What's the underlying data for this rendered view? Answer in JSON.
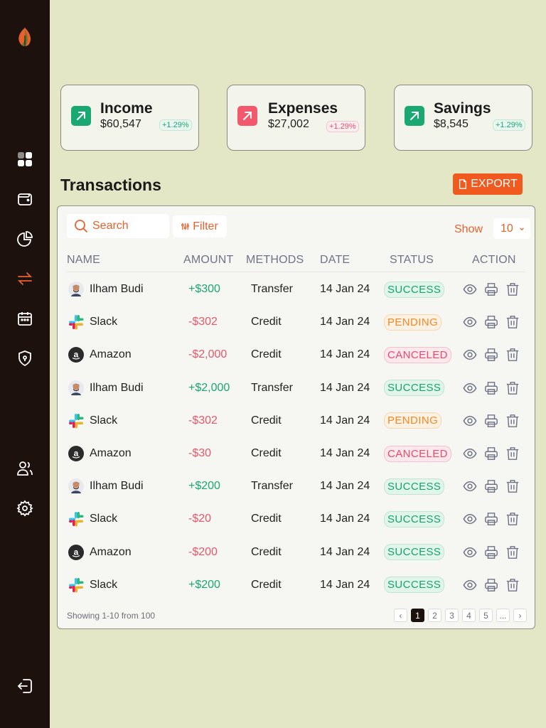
{
  "colors": {
    "sidebar": "#1d110d",
    "accent": "#f05a1f",
    "background": "#e4e7c6",
    "success": "#14a370",
    "pending": "#f08a2c",
    "canceled": "#e84a6a"
  },
  "sidebar": {
    "logo": "leaf-logo",
    "items": [
      {
        "name": "dashboard",
        "icon": "grid-icon"
      },
      {
        "name": "wallet",
        "icon": "wallet-icon"
      },
      {
        "name": "analytics",
        "icon": "pie-chart-icon"
      },
      {
        "name": "transactions",
        "icon": "transfer-icon",
        "active": true
      },
      {
        "name": "calendar",
        "icon": "calendar-icon"
      },
      {
        "name": "security",
        "icon": "shield-icon"
      },
      {
        "name": "users",
        "icon": "users-icon"
      },
      {
        "name": "settings",
        "icon": "gear-icon"
      },
      {
        "name": "logout",
        "icon": "logout-icon"
      }
    ]
  },
  "cards": [
    {
      "title": "Income",
      "value": "$60,547",
      "delta": "+1.29%",
      "color": "#1aa872"
    },
    {
      "title": "Expenses",
      "value": "$27,002",
      "delta": "+1.29%",
      "color": "#f2596c"
    },
    {
      "title": "Savings",
      "value": "$8,545",
      "delta": "+1.29%",
      "color": "#1aa872"
    }
  ],
  "transactions": {
    "title": "Transactions",
    "export_label": "EXPORT",
    "search_placeholder": "Search",
    "filter_label": "Filter",
    "show_label": "Show",
    "show_value": "10",
    "columns": [
      "NAME",
      "AMOUNT",
      "METHODS",
      "DATE",
      "STATUS",
      "ACTION"
    ],
    "rows": [
      {
        "name": "Ilham Budi",
        "avatar": "person-avatar",
        "amount": "+$300",
        "method": "Transfer",
        "date": "14 Jan 24",
        "status": "SUCCESS"
      },
      {
        "name": "Slack",
        "avatar": "slack-logo",
        "amount": "-$302",
        "method": "Credit",
        "date": "14 Jan 24",
        "status": "PENDING"
      },
      {
        "name": "Amazon",
        "avatar": "amazon-logo",
        "amount": "-$2,000",
        "method": "Credit",
        "date": "14 Jan 24",
        "status": "CANCELED"
      },
      {
        "name": "Ilham Budi",
        "avatar": "person-avatar",
        "amount": "+$2,000",
        "method": "Transfer",
        "date": "14 Jan 24",
        "status": "SUCCESS"
      },
      {
        "name": "Slack",
        "avatar": "slack-logo",
        "amount": "-$302",
        "method": "Credit",
        "date": "14 Jan 24",
        "status": "PENDING"
      },
      {
        "name": "Amazon",
        "avatar": "amazon-logo",
        "amount": "-$30",
        "method": "Credit",
        "date": "14 Jan 24",
        "status": "CANCELED"
      },
      {
        "name": "Ilham Budi",
        "avatar": "person-avatar",
        "amount": "+$200",
        "method": "Transfer",
        "date": "14 Jan 24",
        "status": "SUCCESS"
      },
      {
        "name": "Slack",
        "avatar": "slack-logo",
        "amount": "-$20",
        "method": "Credit",
        "date": "14 Jan 24",
        "status": "SUCCESS"
      },
      {
        "name": "Amazon",
        "avatar": "amazon-logo",
        "amount": "-$200",
        "method": "Credit",
        "date": "14 Jan 24",
        "status": "SUCCESS"
      },
      {
        "name": "Slack",
        "avatar": "slack-logo",
        "amount": "+$200",
        "method": "Credit",
        "date": "14 Jan 24",
        "status": "SUCCESS"
      }
    ],
    "actions": [
      "eye-icon",
      "print-icon",
      "trash-icon"
    ],
    "footer": "Showing 1-10 from 100",
    "pagination": [
      "‹",
      "1",
      "2",
      "3",
      "4",
      "5",
      "...",
      "›"
    ],
    "current_page": "1"
  }
}
